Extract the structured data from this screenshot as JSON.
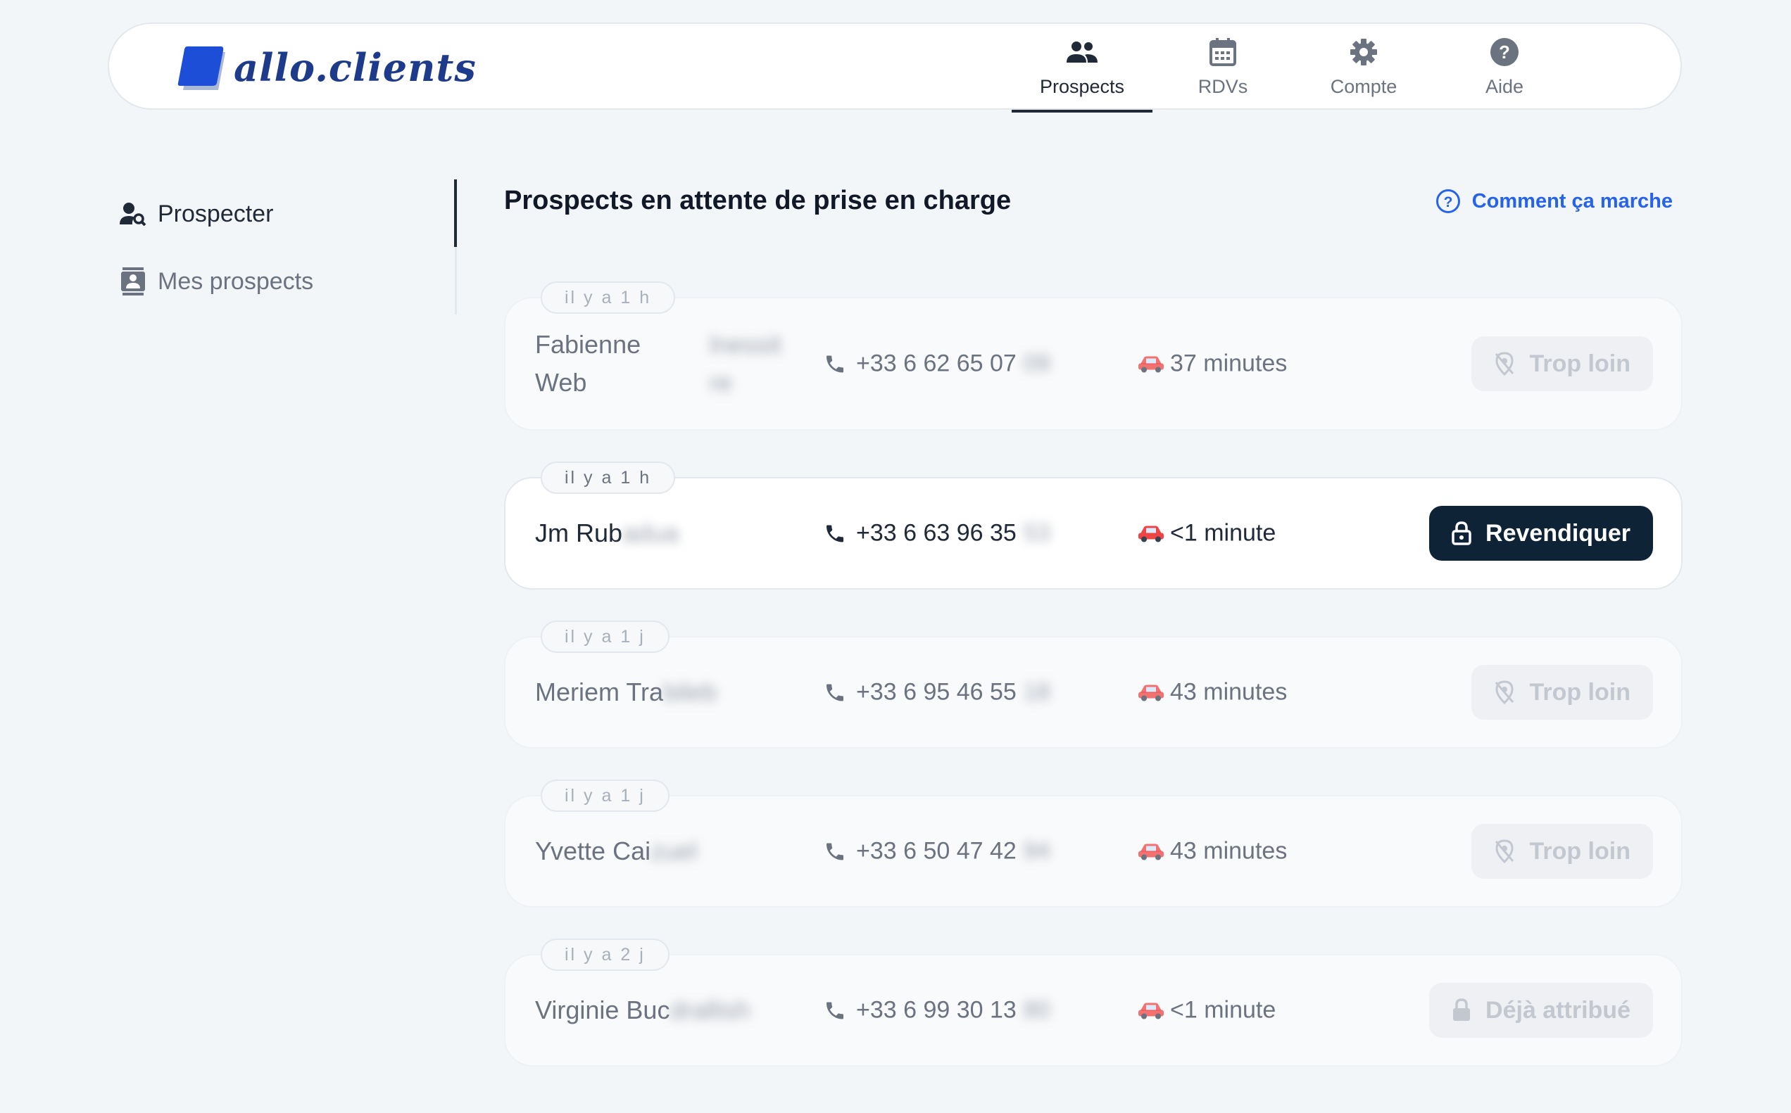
{
  "header": {
    "logo_text": "allo.clients",
    "nav": [
      {
        "label": "Prospects",
        "icon": "people-icon",
        "active": true
      },
      {
        "label": "RDVs",
        "icon": "calendar-icon",
        "active": false
      },
      {
        "label": "Compte",
        "icon": "gear-icon",
        "active": false
      },
      {
        "label": "Aide",
        "icon": "help-circle-icon",
        "active": false
      }
    ]
  },
  "sidebar": {
    "items": [
      {
        "label": "Prospecter",
        "icon": "person-search-icon",
        "active": true
      },
      {
        "label": "Mes prospects",
        "icon": "contact-card-icon",
        "active": false
      }
    ]
  },
  "main": {
    "title": "Prospects en attente de prise en charge",
    "help_link": "Comment ça marche",
    "prospects": [
      {
        "age": "il y a 1 h",
        "name": "Fabienne",
        "name_line2": "Web",
        "name_hidden": "",
        "extra_hidden": "lnessit re",
        "phone": "+33 6 62 65 07",
        "phone_hidden": "09",
        "distance": "37 minutes",
        "action": "Trop loin",
        "action_icon": "location-off-icon",
        "state": "disabled"
      },
      {
        "age": "il y a 1 h",
        "name": "Jm Rub",
        "name_hidden": "adua",
        "phone": "+33 6 63 96 35",
        "phone_hidden": "53",
        "distance": "<1 minute",
        "action": "Revendiquer",
        "action_icon": "lock-open-icon",
        "state": "primary"
      },
      {
        "age": "il y a 1 j",
        "name": "Meriem Tra",
        "name_hidden": "bileb",
        "phone": "+33 6 95 46 55",
        "phone_hidden": "18",
        "distance": "43 minutes",
        "action": "Trop loin",
        "action_icon": "location-off-icon",
        "state": "disabled"
      },
      {
        "age": "il y a 1 j",
        "name": "Yvette Cai",
        "name_hidden": "zuel",
        "phone": "+33 6 50 47 42",
        "phone_hidden": "94",
        "distance": "43 minutes",
        "action": "Trop loin",
        "action_icon": "location-off-icon",
        "state": "disabled"
      },
      {
        "age": "il y a 2 j",
        "name": "Virginie Buc",
        "name_hidden": "drallish",
        "phone": "+33 6 99 30 13",
        "phone_hidden": "80",
        "distance": "<1 minute",
        "action": "Déjà attribué",
        "action_icon": "lock-icon",
        "state": "disabled"
      }
    ]
  },
  "colors": {
    "primary_button": "#0f2337",
    "link": "#2563eb",
    "logo": "#1e3a8a"
  }
}
